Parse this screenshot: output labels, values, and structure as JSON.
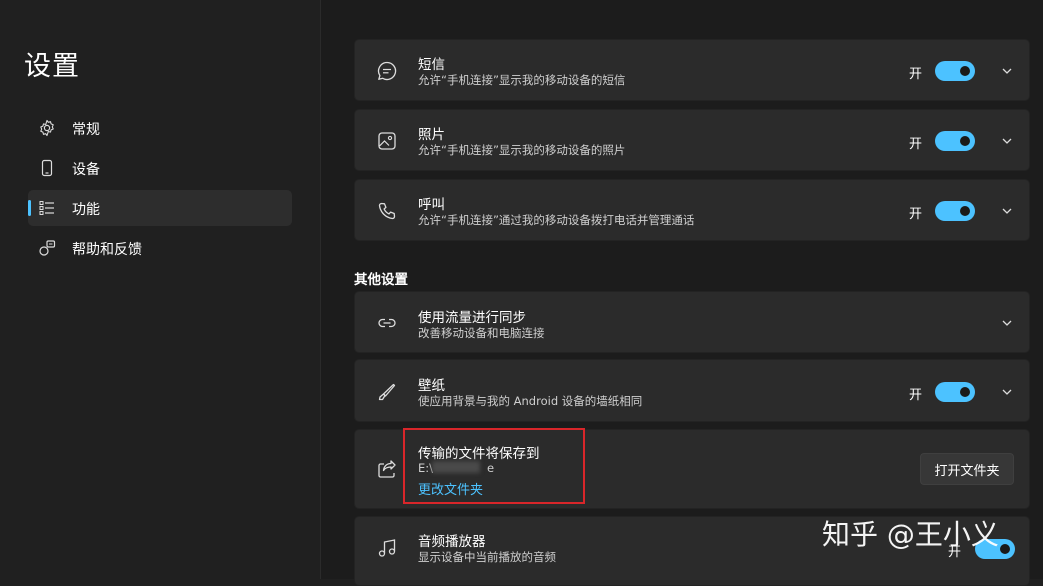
{
  "app": {
    "title": "设置"
  },
  "sidebar": {
    "items": [
      {
        "label": "常规",
        "icon": "gear-icon"
      },
      {
        "label": "设备",
        "icon": "phone-icon"
      },
      {
        "label": "功能",
        "icon": "list-icon",
        "active": true
      },
      {
        "label": "帮助和反馈",
        "icon": "help-feedback-icon"
      }
    ]
  },
  "features": [
    {
      "title": "短信",
      "desc": "允许“手机连接”显示我的移动设备的短信",
      "state": "开",
      "enabled": true,
      "icon": "message-icon"
    },
    {
      "title": "照片",
      "desc": "允许“手机连接”显示我的移动设备的照片",
      "state": "开",
      "enabled": true,
      "icon": "photo-icon"
    },
    {
      "title": "呼叫",
      "desc": "允许“手机连接”通过我的移动设备拨打电话并管理通话",
      "state": "开",
      "enabled": true,
      "icon": "call-icon"
    }
  ],
  "other": {
    "section_title": "其他设置",
    "sync": {
      "title": "使用流量进行同步",
      "desc": "改善移动设备和电脑连接",
      "icon": "link-icon"
    },
    "wallpaper": {
      "title": "壁纸",
      "desc": "使应用背景与我的 Android 设备的墙纸相同",
      "state": "开",
      "enabled": true,
      "icon": "brush-icon"
    },
    "transfer": {
      "title": "传输的文件将保存到",
      "path_prefix": "E:\\",
      "path_suffix": "e",
      "change_link": "更改文件夹",
      "open_button": "打开文件夹",
      "icon": "share-icon"
    },
    "audio": {
      "title": "音频播放器",
      "desc": "显示设备中当前播放的音频",
      "state": "开",
      "enabled": true,
      "icon": "music-icon"
    }
  },
  "watermark": "知乎 @王小义",
  "colors": {
    "accent": "#4cc2ff",
    "highlight_box": "#d9262a",
    "card": "#2b2b2b",
    "background": "#1c1c1c"
  }
}
